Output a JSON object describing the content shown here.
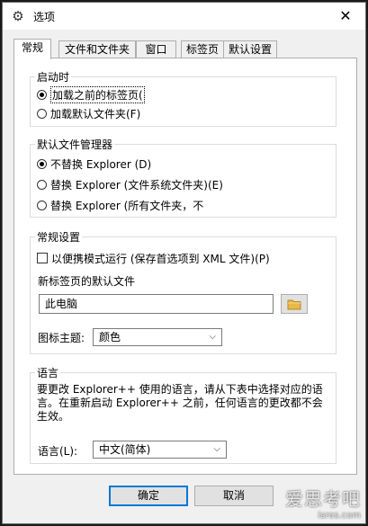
{
  "window": {
    "title": "选项",
    "close_glyph": "✕"
  },
  "tabs": [
    {
      "label": "常规",
      "active": true
    },
    {
      "label": "文件和文件夹",
      "active": false
    },
    {
      "label": "窗口",
      "active": false
    },
    {
      "label": "标签页",
      "active": false
    },
    {
      "label": "默认设置",
      "active": false
    }
  ],
  "startup": {
    "legend": "启动时",
    "options": [
      {
        "label": "加载之前的标签页(",
        "checked": true
      },
      {
        "label": "加载默认文件夹(F)",
        "checked": false
      }
    ]
  },
  "file_manager": {
    "legend": "默认文件管理器",
    "options": [
      {
        "label": "不替换 Explorer (D)",
        "checked": true
      },
      {
        "label": "替换 Explorer (文件系统文件夹)(E)",
        "checked": false
      },
      {
        "label": "替换 Explorer (所有文件夹，不",
        "checked": false
      }
    ]
  },
  "general": {
    "legend": "常规设置",
    "portable_label": "以便携模式运行 (保存首选项到 XML 文件)(P)",
    "portable_checked": false,
    "newtab_label": "新标签页的默认文件",
    "newtab_value": "此电脑",
    "icon_theme_label": "图标主题:",
    "icon_theme_value": "颜色"
  },
  "language": {
    "legend": "语言",
    "description": "要更改 Explorer++ 使用的语言，请从下表中选择对应的语言。在重新启动 Explorer++ 之前，任何语言的更改都不会生效。",
    "label": "语言(L):",
    "value": "中文(简体)"
  },
  "buttons": {
    "ok": "确定",
    "cancel": "取消"
  },
  "watermark": {
    "main": "爱思考吧",
    "sub": "isres.com"
  },
  "colors": {
    "accent": "#0078d7",
    "folder": "#e8b84a"
  },
  "icons": {
    "title": "gear-icon",
    "folder": "folder-icon",
    "dropdown": "chevron-down-icon"
  }
}
